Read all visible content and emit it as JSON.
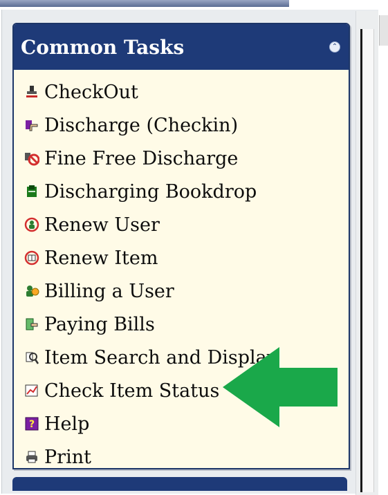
{
  "panel": {
    "title": "Common Tasks",
    "collapse_icon": "double-chevron-up-icon"
  },
  "tasks": [
    {
      "label": "CheckOut",
      "icon": "stamp-icon"
    },
    {
      "label": "Discharge (Checkin)",
      "icon": "hand-book-icon"
    },
    {
      "label": "Fine Free Discharge",
      "icon": "no-fine-icon"
    },
    {
      "label": "Discharging Bookdrop",
      "icon": "bookdrop-icon"
    },
    {
      "label": "Renew User",
      "icon": "renew-user-icon"
    },
    {
      "label": "Renew Item",
      "icon": "renew-item-icon"
    },
    {
      "label": "Billing a User",
      "icon": "billing-icon"
    },
    {
      "label": "Paying Bills",
      "icon": "paying-bills-icon"
    },
    {
      "label": "Item Search and Display",
      "icon": "item-search-icon"
    },
    {
      "label": "Check Item Status",
      "icon": "item-status-icon"
    },
    {
      "label": "Help",
      "icon": "help-icon"
    },
    {
      "label": "Print",
      "icon": "printer-icon"
    }
  ],
  "colors": {
    "header": "#1e3a78",
    "panel_bg": "#fffbe7",
    "arrow": "#1aa84a"
  }
}
